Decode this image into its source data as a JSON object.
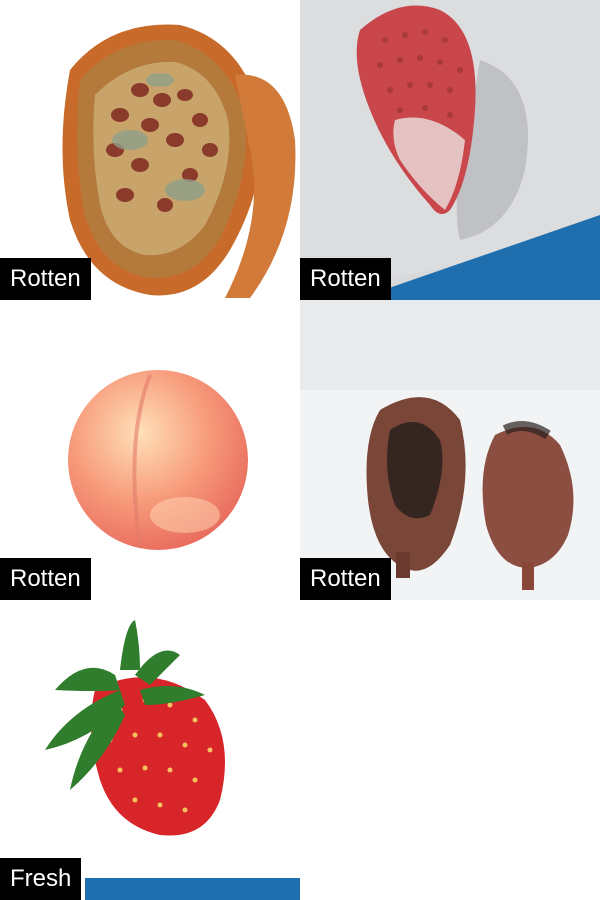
{
  "tiles": [
    {
      "subject": "rotten-pomegranate",
      "label": "Rotten"
    },
    {
      "subject": "moldy-strawberry",
      "label": "Rotten"
    },
    {
      "subject": "peach",
      "label": "Rotten"
    },
    {
      "subject": "rotten-pomegranates",
      "label": "Rotten"
    },
    {
      "subject": "fresh-strawberry",
      "label": "Fresh"
    }
  ],
  "colors": {
    "label_bg": "#000000",
    "label_text": "#ffffff",
    "stock_banner": "#1f6fae"
  }
}
